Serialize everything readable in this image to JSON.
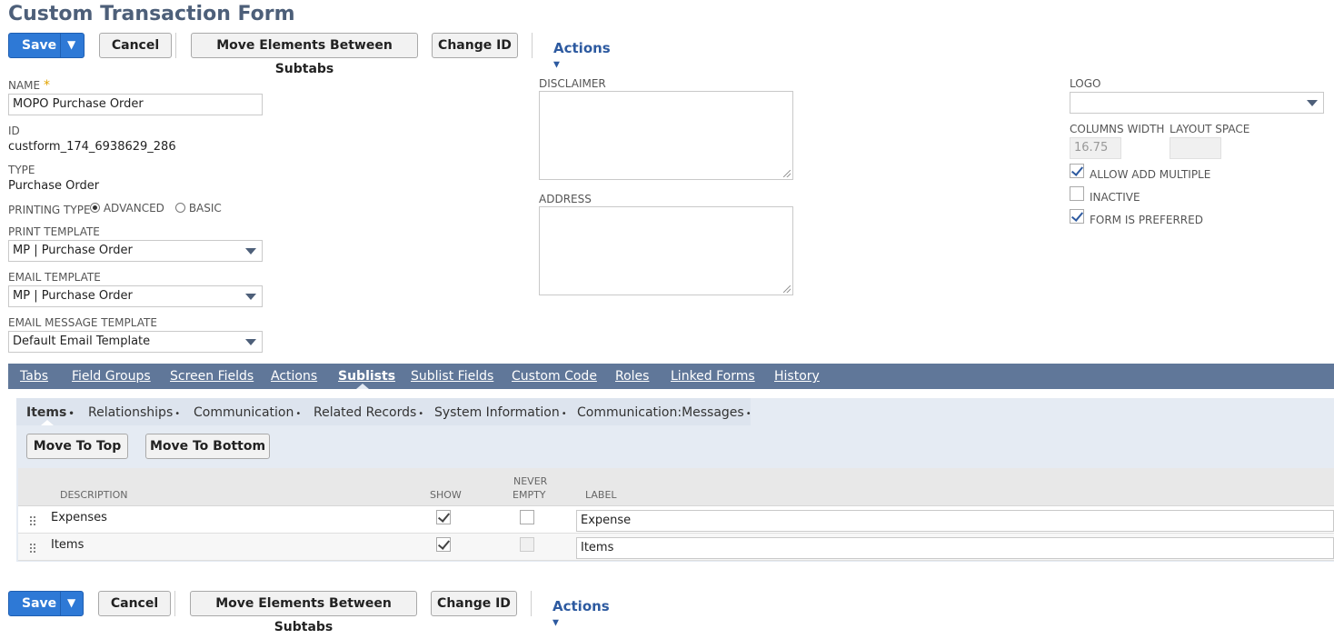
{
  "page": {
    "title": "Custom Transaction Form"
  },
  "toolbar": {
    "save_label": "Save",
    "save_arrow": "▼",
    "cancel_label": "Cancel",
    "move_elements_label": "Move Elements Between Subtabs",
    "change_id_label": "Change ID",
    "actions_label": "Actions",
    "actions_caret": "▼"
  },
  "form": {
    "name_label": "NAME",
    "required_mark": "*",
    "name_value": "MOPO Purchase Order",
    "id_label": "ID",
    "id_value": "custform_174_6938629_286",
    "type_label": "TYPE",
    "type_value": "Purchase Order",
    "printing_type_label": "PRINTING TYPE",
    "printing_options": {
      "advanced": "ADVANCED",
      "basic": "BASIC"
    },
    "printing_selected": "advanced",
    "print_template_label": "PRINT TEMPLATE",
    "print_template_value": "MP | Purchase Order",
    "email_template_label": "EMAIL TEMPLATE",
    "email_template_value": "MP | Purchase Order",
    "email_message_template_label": "EMAIL MESSAGE TEMPLATE",
    "email_message_template_value": "Default Email Template",
    "disclaimer_label": "DISCLAIMER",
    "disclaimer_value": "",
    "address_label": "ADDRESS",
    "address_value": "",
    "logo_label": "LOGO",
    "logo_value": "",
    "columns_width_label": "COLUMNS WIDTH",
    "columns_width_value": "16.75",
    "layout_space_label": "LAYOUT SPACE",
    "layout_space_value": "",
    "allow_add_multiple_label": "ALLOW ADD MULTIPLE",
    "allow_add_multiple": true,
    "inactive_label": "INACTIVE",
    "inactive": false,
    "form_is_preferred_label": "FORM IS PREFERRED",
    "form_is_preferred": true
  },
  "tabs": [
    {
      "label": "Tabs"
    },
    {
      "label": "Field Groups"
    },
    {
      "label": "Screen Fields"
    },
    {
      "label": "Actions"
    },
    {
      "label": "Sublists"
    },
    {
      "label": "Sublist Fields"
    },
    {
      "label": "Custom Code"
    },
    {
      "label": "Roles"
    },
    {
      "label": "Linked Forms"
    },
    {
      "label": "History"
    }
  ],
  "active_tab": "Sublists",
  "subtabs": [
    {
      "label": "Items",
      "dot": "•"
    },
    {
      "label": "Relationships",
      "dot": "•"
    },
    {
      "label": "Communication",
      "dot": "•"
    },
    {
      "label": "Related Records",
      "dot": "•"
    },
    {
      "label": "System Information",
      "dot": "•"
    },
    {
      "label": "Communication:Messages",
      "dot": "•"
    }
  ],
  "active_subtab": "Items",
  "sublist_buttons": {
    "move_top": "Move To Top",
    "move_bottom": "Move To Bottom"
  },
  "table": {
    "headers": {
      "description": "DESCRIPTION",
      "show": "SHOW",
      "never_empty_1": "NEVER",
      "never_empty_2": "EMPTY",
      "label": "LABEL"
    },
    "rows": [
      {
        "description": "Expenses",
        "show": true,
        "never_empty": false,
        "label": "Expense"
      },
      {
        "description": "Items",
        "show": true,
        "never_empty": false,
        "label": "Items"
      }
    ]
  },
  "colors": {
    "tabbar": "#607799",
    "primary": "#2e79d6",
    "title": "#4d5f79",
    "link": "#2d5aa0"
  }
}
